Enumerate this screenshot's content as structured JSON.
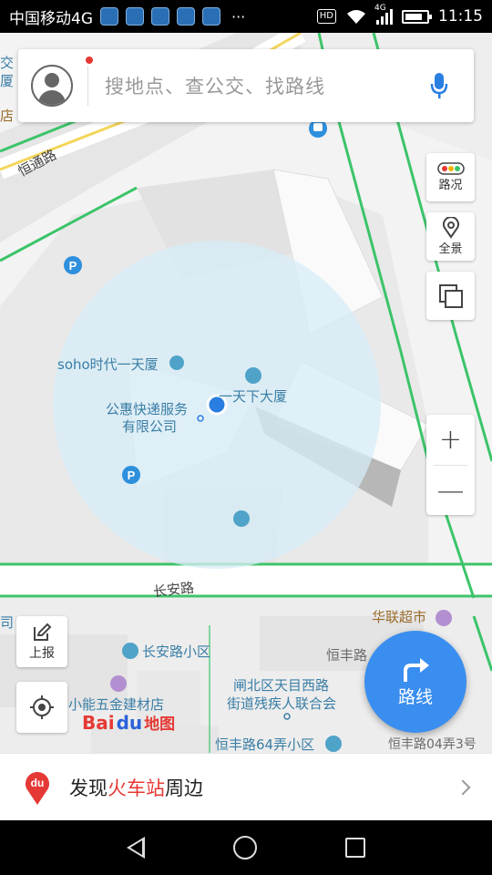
{
  "status_bar": {
    "carrier": "中国移动4G",
    "more": "···",
    "hd": "HD",
    "net": "4G",
    "time": "11:15"
  },
  "search": {
    "placeholder": "搜地点、查公交、找路线"
  },
  "side_buttons": {
    "traffic": "路况",
    "panorama": "全景"
  },
  "zoom": {
    "in": "+",
    "out": "—"
  },
  "left_buttons": {
    "report": "上报"
  },
  "route_button": "路线",
  "map_labels": {
    "road_hengtong": "恒通路",
    "road_changan": "长安路",
    "poi_soho": "soho时代一天厦",
    "poi_tianxia": "一天下大厦",
    "poi_gonghui_1": "公惠快递服务",
    "poi_gonghui_2": "有限公司",
    "poi_hualian": "华联超市",
    "poi_changan_xiaoqu": "长安路小区",
    "poi_hengfeng": "恒丰路",
    "poi_xiaoneng": "小能五金建材店",
    "poi_zhabei_1": "闸北区天目西路",
    "poi_zhabei_2": "街道残疾人联合会",
    "poi_hengfeng64": "恒丰路64弄小区",
    "poi_hengfeng04": "恒丰路04弄3号",
    "edge_jiao": "交",
    "edge_sha": "厦",
    "edge_dian": "店",
    "edge_si": "司"
  },
  "logo": {
    "bai": "Bai",
    "du": "du",
    "ditu": "地图"
  },
  "bottom_card": {
    "prefix": "发现",
    "highlight": "火车站",
    "suffix": "周边"
  },
  "colors": {
    "accent": "#3a8ef0",
    "road_green": "#3cc46a",
    "location_circle": "#d7ecf7",
    "highlight_red": "#e53935"
  }
}
